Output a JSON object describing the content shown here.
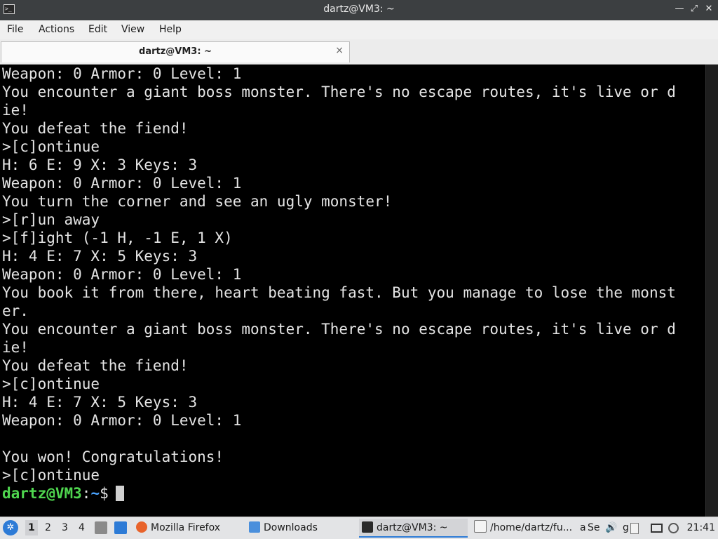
{
  "window": {
    "title": "dartz@VM3: ~",
    "minimize_glyph": "—",
    "maximize_glyph": "⤢",
    "close_glyph": "✕"
  },
  "menu": [
    "File",
    "Actions",
    "Edit",
    "View",
    "Help"
  ],
  "tab": {
    "label": "dartz@VM3: ~",
    "close_glyph": "×"
  },
  "terminal": {
    "lines": [
      "Weapon: 0 Armor: 0 Level: 1",
      "You encounter a giant boss monster. There's no escape routes, it's live or d",
      "ie!",
      "You defeat the fiend!",
      ">[c]ontinue",
      "H: 6 E: 9 X: 3 Keys: 3",
      "Weapon: 0 Armor: 0 Level: 1",
      "You turn the corner and see an ugly monster!",
      ">[r]un away",
      ">[f]ight (-1 H, -1 E, 1 X)",
      "H: 4 E: 7 X: 5 Keys: 3",
      "Weapon: 0 Armor: 0 Level: 1",
      "You book it from there, heart beating fast. But you manage to lose the monst",
      "er.",
      "You encounter a giant boss monster. There's no escape routes, it's live or d",
      "ie!",
      "You defeat the fiend!",
      ">[c]ontinue",
      "H: 4 E: 7 X: 5 Keys: 3",
      "Weapon: 0 Armor: 0 Level: 1",
      "",
      "You won! Congratulations!",
      ">[c]ontinue"
    ],
    "prompt": {
      "user_host": "dartz@VM3",
      "separator": ":",
      "path": "~",
      "symbol": "$"
    }
  },
  "taskbar": {
    "workspaces": [
      "1",
      "2",
      "3",
      "4"
    ],
    "tasks": [
      {
        "label": "Mozilla Firefox",
        "icon": "firefox-icon"
      },
      {
        "label": "Downloads",
        "icon": "folder-icon"
      },
      {
        "label": "dartz@VM3: ~",
        "icon": "terminal-icon"
      },
      {
        "label": "/home/dartz/fu...",
        "icon": "text-editor-icon"
      }
    ],
    "tray": {
      "truncated_a": "a",
      "truncated_se": "Se",
      "truncated_g": "g"
    },
    "clock": "21:41"
  },
  "colors": {
    "titlebar": "#3c3f41",
    "terminal_bg": "#000000",
    "terminal_fg": "#e4e4e4",
    "prompt_user": "#4fd64f",
    "prompt_path": "#4aa3ff",
    "accent": "#2d7bd6"
  }
}
